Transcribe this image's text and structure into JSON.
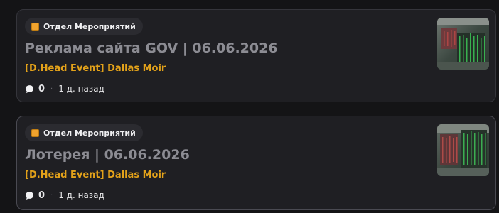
{
  "posts": [
    {
      "category": "Отдел Мероприятий",
      "title": "Реклама сайта GOV | 06.06.2026",
      "author": "[D.Head Event] Dallas Moir",
      "comments": "0",
      "time": "1 д. назад"
    },
    {
      "category": "Отдел Мероприятий",
      "title": "Лотерея | 06.06.2026",
      "author": "[D.Head Event] Dallas Moir",
      "comments": "0",
      "time": "1 д. назад"
    }
  ],
  "colors": {
    "background": "#141416",
    "card": "#1f1f23",
    "accent": "#e3a21a",
    "badge_icon": "#f0a32e",
    "title": "#8c8c93"
  },
  "icons": {
    "badge": "orange-square-icon",
    "comments": "speech-bubble-icon"
  }
}
